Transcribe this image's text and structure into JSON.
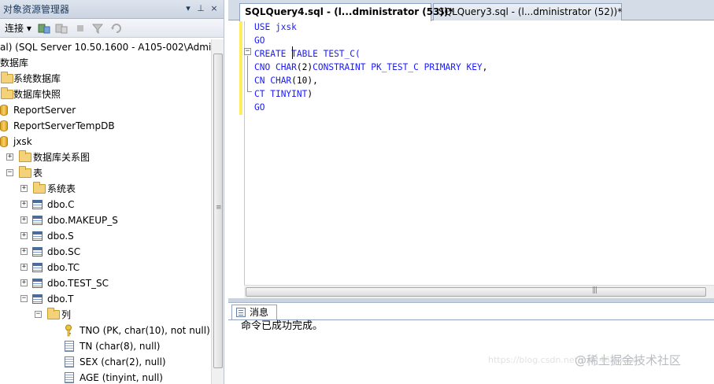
{
  "object_explorer": {
    "title": "对象资源管理器",
    "pin_glyph": "▾ ↧",
    "close_glyph": "×",
    "toolbar": {
      "connect_label": "连接 ▾"
    },
    "tree": [
      {
        "label": "al) (SQL Server 10.50.1600 - A105-002\\Admini",
        "icon": "server-icon",
        "expander": ""
      },
      {
        "label": "数据库",
        "icon": "",
        "expander": ""
      },
      {
        "label": "系统数据库",
        "icon": "folder-icon",
        "expander": ""
      },
      {
        "label": "数据库快照",
        "icon": "folder-icon",
        "expander": ""
      },
      {
        "label": "ReportServer",
        "icon": "database-icon",
        "expander": ""
      },
      {
        "label": "ReportServerTempDB",
        "icon": "database-icon",
        "expander": ""
      },
      {
        "label": "jxsk",
        "icon": "database-icon",
        "expander": ""
      },
      {
        "label": "数据库关系图",
        "icon": "folder-icon",
        "expander": "+"
      },
      {
        "label": "表",
        "icon": "folder-icon",
        "expander": "−"
      },
      {
        "label": "系统表",
        "icon": "folder-icon",
        "expander": "+"
      },
      {
        "label": "dbo.C",
        "icon": "table-icon",
        "expander": "+"
      },
      {
        "label": "dbo.MAKEUP_S",
        "icon": "table-icon",
        "expander": "+"
      },
      {
        "label": "dbo.S",
        "icon": "table-icon",
        "expander": "+"
      },
      {
        "label": "dbo.SC",
        "icon": "table-icon",
        "expander": "+"
      },
      {
        "label": "dbo.TC",
        "icon": "table-icon",
        "expander": "+"
      },
      {
        "label": "dbo.TEST_SC",
        "icon": "table-icon",
        "expander": "+"
      },
      {
        "label": "dbo.T",
        "icon": "table-icon",
        "expander": "−"
      },
      {
        "label": "列",
        "icon": "folder-icon",
        "expander": "−"
      },
      {
        "label": "TNO (PK, char(10), not null)",
        "icon": "key-icon",
        "expander": ""
      },
      {
        "label": "TN (char(8), null)",
        "icon": "column-icon",
        "expander": ""
      },
      {
        "label": "SEX (char(2), null)",
        "icon": "column-icon",
        "expander": ""
      },
      {
        "label": "AGE (tinyint, null)",
        "icon": "column-icon",
        "expander": ""
      }
    ]
  },
  "tabs": [
    {
      "label": "SQLQuery4.sql - (l...dministrator (53))*",
      "active": true
    },
    {
      "label": "SQLQuery3.sql - (l...dministrator (52))*",
      "active": false
    }
  ],
  "editor": {
    "lines": [
      {
        "parts": [
          {
            "t": "USE ",
            "c": "kw"
          },
          {
            "t": "jxsk",
            "c": "kw"
          }
        ]
      },
      {
        "parts": [
          {
            "t": "GO",
            "c": "kw"
          }
        ]
      },
      {
        "parts": [
          {
            "t": "CREATE",
            "c": "kw"
          },
          {
            "t": " ",
            "c": "id"
          },
          {
            "t": "TABLE",
            "c": "kw"
          },
          {
            "t": " TEST_C(",
            "c": "kw"
          }
        ]
      },
      {
        "parts": [
          {
            "t": "CNO ",
            "c": "kw"
          },
          {
            "t": "CHAR",
            "c": "kw"
          },
          {
            "t": "(2)",
            "c": "id"
          },
          {
            "t": "CONSTRAINT",
            "c": "kw"
          },
          {
            "t": " PK_TEST_C ",
            "c": "kw"
          },
          {
            "t": "PRIMARY KEY",
            "c": "kw"
          },
          {
            "t": ",",
            "c": "id"
          }
        ]
      },
      {
        "parts": [
          {
            "t": "CN ",
            "c": "kw"
          },
          {
            "t": "CHAR",
            "c": "kw"
          },
          {
            "t": "(10),",
            "c": "id"
          }
        ]
      },
      {
        "parts": [
          {
            "t": "CT ",
            "c": "kw"
          },
          {
            "t": "TINYINT",
            "c": "kw"
          },
          {
            "t": ")",
            "c": "id"
          }
        ]
      },
      {
        "parts": [
          {
            "t": "GO",
            "c": "kw"
          }
        ]
      }
    ]
  },
  "results": {
    "tab_label": "消息",
    "message": "命令已成功完成。"
  },
  "watermark": {
    "url_text": "https://blog.csdn.net/m0_46xxxxxx",
    "brand_text": "@稀土掘金技术社区"
  },
  "colors": {
    "keyword": "#1a1aff",
    "tab_strip": "#d4dce8",
    "margin_change": "#ffee58"
  }
}
